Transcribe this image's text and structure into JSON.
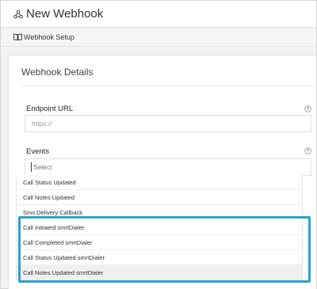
{
  "page": {
    "title": "New Webhook"
  },
  "subnav": {
    "label": "Webhook Setup"
  },
  "card": {
    "title": "Webhook Details",
    "endpoint": {
      "label": "Endpoint URL",
      "placeholder": "https://"
    },
    "events": {
      "label": "Events",
      "placeholder": "Select",
      "options": [
        "Call Status Updated",
        "Call Notes Updated",
        "Sms Delivery Callback",
        "Call Initiated smrtDialer",
        "Call Completed smrtDialer",
        "Call Status Updated smrtDialer",
        "Call Notes Updated smrtDialer"
      ],
      "highlighted_options": [
        "Call Initiated smrtDialer",
        "Call Completed smrtDialer",
        "Call Status Updated smrtDialer",
        "Call Notes Updated smrtDialer"
      ],
      "hovered_option": "Call Notes Updated smrtDialer"
    }
  },
  "colors": {
    "highlight": "#29a3d3",
    "page_bg": "#f2f2f2",
    "card_bg": "#ffffff"
  },
  "icons": {
    "title": "webhook-icon",
    "subnav": "book-icon",
    "help": "help-circle-icon"
  }
}
